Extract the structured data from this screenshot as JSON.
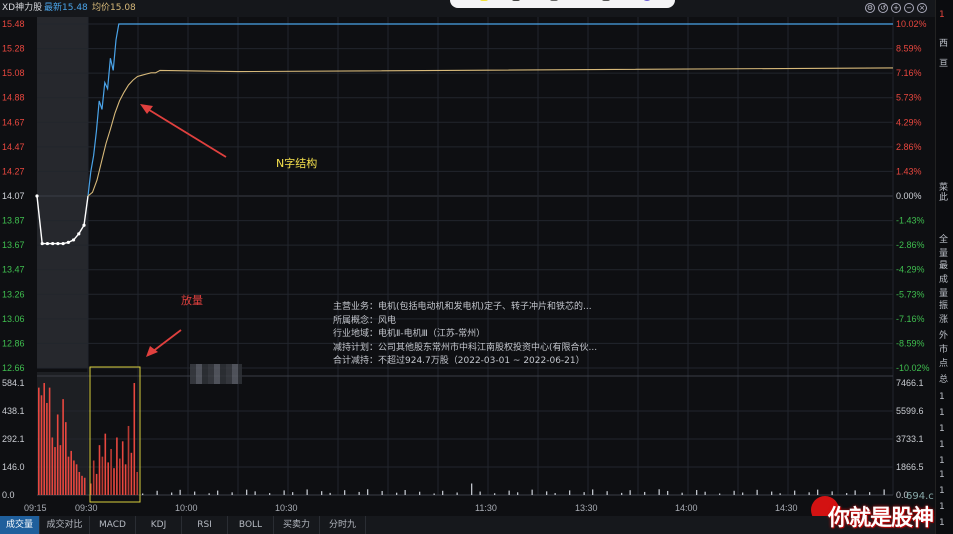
{
  "header": {
    "stock_name": "XD神力股",
    "latest_label": "最新15.48",
    "avg_label": "均价15.08"
  },
  "price_axis": {
    "left": [
      "15.48",
      "15.28",
      "15.08",
      "14.88",
      "14.67",
      "14.47",
      "14.27",
      "14.07",
      "13.87",
      "13.67",
      "13.47",
      "13.26",
      "13.06",
      "12.86",
      "12.66"
    ],
    "right": [
      "10.02%",
      "8.59%",
      "7.16%",
      "5.73%",
      "4.29%",
      "2.86%",
      "1.43%",
      "0.00%",
      "-1.43%",
      "-2.86%",
      "-4.29%",
      "-5.73%",
      "-7.16%",
      "-8.59%",
      "-10.02%"
    ]
  },
  "volume_axis": {
    "left": [
      "584.1",
      "438.1",
      "292.1",
      "146.0",
      "0.0"
    ],
    "right": [
      "7466.1",
      "5599.6",
      "3733.1",
      "1866.5",
      "0.0"
    ]
  },
  "time_axis": [
    "09:15",
    "09:30",
    "10:00",
    "10:30",
    "11:30",
    "13:30",
    "14:00",
    "14:30"
  ],
  "annotations": {
    "n_structure": "N字结构",
    "volume_up": "放量"
  },
  "info_panel": {
    "lines": [
      "主营业务：电机(包括电动机和发电机)定子、转子冲片和铁芯的...",
      "所属概念：风电",
      "行业地域：电机Ⅱ-电机Ⅲ（江苏-常州）",
      "减持计划：公司其他股东常州市中科江南股权投资中心(有限合伙...",
      "合计减持：不超过924.7万股（2022-03-01 ~ 2022-06-21）"
    ]
  },
  "tabs": [
    "成交量",
    "成交对比",
    "MACD",
    "KDJ",
    "RSI",
    "BOLL",
    "买卖力道",
    "分时九转"
  ],
  "side_chars": [
    "1",
    "西",
    "亘",
    "菜",
    "此",
    "全",
    "量",
    "最",
    "成",
    "量",
    "振",
    "涨",
    "外",
    "市",
    "点",
    "总",
    "1",
    "1",
    "1",
    "1",
    "1",
    "1",
    "1",
    "1",
    "1"
  ],
  "watermark": {
    "text": "你就是股神",
    "url": "694.c"
  },
  "chart_data": {
    "type": "line",
    "prev_close": 14.07,
    "ylim": [
      12.66,
      15.48
    ],
    "series": [
      {
        "values_auction": [
          14.07,
          13.68,
          13.68,
          13.68,
          13.68,
          13.68,
          13.69,
          13.71,
          13.76,
          13.83
        ],
        "price": [
          14.07,
          14.27,
          14.4,
          14.6,
          14.85,
          14.78,
          15.0,
          14.95,
          15.2,
          15.1,
          15.35,
          15.48,
          15.48,
          15.48,
          15.48,
          15.48
        ],
        "avg": [
          14.07,
          14.1,
          14.2,
          14.35,
          14.5,
          14.62,
          14.75,
          14.85,
          14.92,
          14.98,
          15.02,
          15.05,
          15.06,
          15.07,
          15.08,
          15.08,
          15.1
        ]
      }
    ],
    "volume_auction": [
      560,
      520,
      584,
      480,
      560,
      300,
      250,
      420,
      260,
      500,
      380,
      200,
      230,
      180,
      160,
      120,
      100,
      90
    ],
    "volume_session": [
      60,
      180,
      110,
      260,
      200,
      320,
      170,
      240,
      140,
      300,
      190,
      280,
      160,
      360,
      220,
      584,
      120
    ],
    "volume_tail_ticks": 60
  },
  "colors": {
    "up": "#e8473f",
    "down": "#3fbf4f",
    "price_line": "#4aa3e8",
    "avg_line": "#d7b97a",
    "auction_line": "#ffffff",
    "grid": "#22262d",
    "box": "#d8cf3c"
  }
}
